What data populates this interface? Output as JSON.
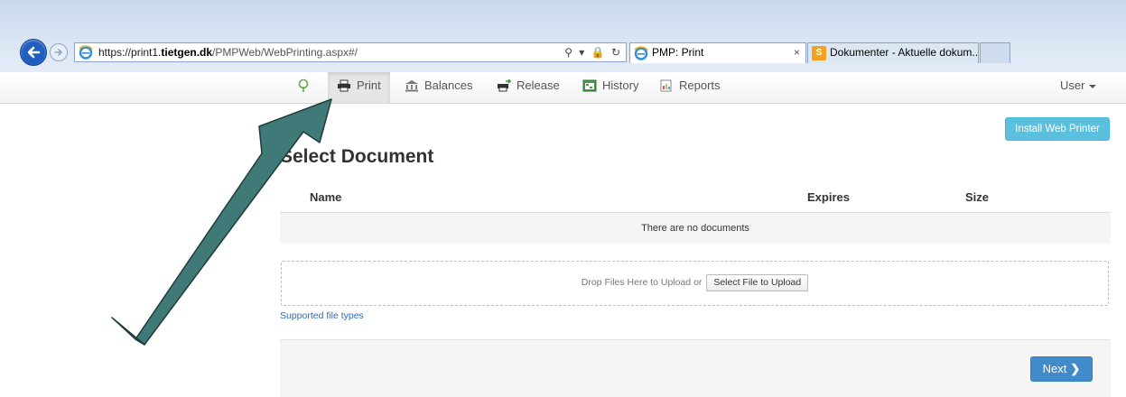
{
  "browser": {
    "url_domain": "https://print1.",
    "url_domain_bold": "tietgen.dk",
    "url_path": "/PMPWeb/WebPrinting.aspx#/",
    "address_tools": "⚲ ▾ 🔒 ↻",
    "tabs": [
      {
        "label": "PMP: Print",
        "close": "×"
      },
      {
        "label": "Dokumenter - Aktuelle dokum..."
      }
    ],
    "sharepoint_icon_letter": "S"
  },
  "nav": {
    "items": [
      {
        "label": "Print"
      },
      {
        "label": "Balances"
      },
      {
        "label": "Release"
      },
      {
        "label": "History"
      },
      {
        "label": "Reports"
      }
    ],
    "user_label": "User"
  },
  "content": {
    "install_button": "Install Web Printer",
    "title": "Select Document",
    "columns": [
      "Name",
      "Expires",
      "Size"
    ],
    "empty_message": "There are no documents",
    "dropzone_text": "Drop Files Here to Upload or",
    "select_file_button": "Select File to Upload",
    "supported_link": "Supported file types",
    "next_button": "Next",
    "next_chevron": "❯"
  },
  "colors": {
    "next_button": "#428bca",
    "install_button": "#5bc0de",
    "annotation_arrow": "#3f7a78",
    "link": "#2a6bbd"
  }
}
